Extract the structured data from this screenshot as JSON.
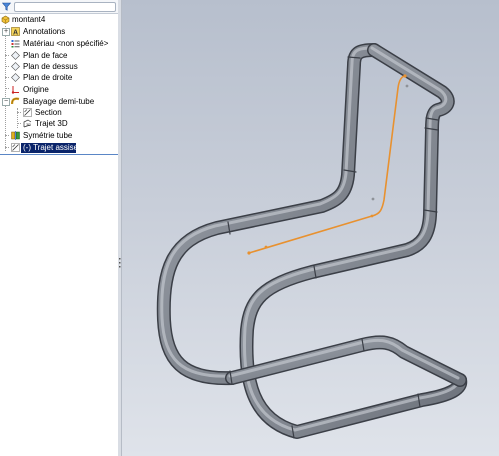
{
  "feature_tree": {
    "filter_placeholder": "",
    "part_name": "montant4",
    "items": [
      {
        "label": "Annotations",
        "icon": "annotations-icon"
      },
      {
        "label": "Matériau <non spécifié>",
        "icon": "material-icon"
      },
      {
        "label": "Plan de face",
        "icon": "plane-icon"
      },
      {
        "label": "Plan de dessus",
        "icon": "plane-icon"
      },
      {
        "label": "Plan de droite",
        "icon": "plane-icon"
      },
      {
        "label": "Origine",
        "icon": "origin-icon"
      },
      {
        "label": "Balayage demi-tube",
        "icon": "sweep-icon"
      },
      {
        "label": "Section",
        "icon": "sketch-icon"
      },
      {
        "label": "Trajet 3D",
        "icon": "3d-sketch-icon"
      },
      {
        "label": "Symétrie tube",
        "icon": "mirror-icon"
      },
      {
        "label": "(-) Trajet assise",
        "icon": "sketch-icon"
      }
    ]
  },
  "colors": {
    "tube": "#8d929b",
    "path": "#e8912f",
    "selection": "#0a246a"
  }
}
